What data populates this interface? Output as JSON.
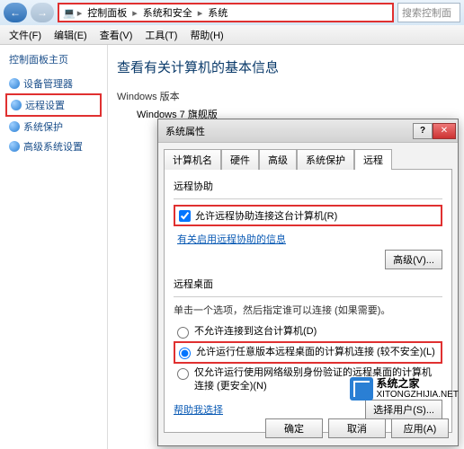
{
  "nav": {
    "crumbs": [
      "控制面板",
      "系统和安全",
      "系统"
    ],
    "search_placeholder": "搜索控制面"
  },
  "menu": [
    "文件(F)",
    "编辑(E)",
    "查看(V)",
    "工具(T)",
    "帮助(H)"
  ],
  "sidebar": {
    "title": "控制面板主页",
    "items": [
      {
        "label": "设备管理器"
      },
      {
        "label": "远程设置"
      },
      {
        "label": "系统保护"
      },
      {
        "label": "高级系统设置"
      }
    ]
  },
  "main": {
    "heading": "查看有关计算机的基本信息",
    "win_section": "Windows 版本",
    "win_edition": "Windows 7 旗舰版"
  },
  "dialog": {
    "title": "系统属性",
    "tabs": [
      "计算机名",
      "硬件",
      "高级",
      "系统保护",
      "远程"
    ],
    "ra_title": "远程协助",
    "ra_check": "允许远程协助连接这台计算机(R)",
    "ra_link": "有关启用远程协助的信息",
    "advanced_btn": "高级(V)...",
    "rd_title": "远程桌面",
    "rd_desc": "单击一个选项，然后指定谁可以连接 (如果需要)。",
    "rd_opts": [
      "不允许连接到这台计算机(D)",
      "允许运行任意版本远程桌面的计算机连接 (较不安全)(L)",
      "仅允许运行使用网络级别身份验证的远程桌面的计算机连接 (更安全)(N)"
    ],
    "help_link": "帮助我选择",
    "select_users": "选择用户(S)...",
    "ok": "确定",
    "cancel": "取消",
    "apply": "应用(A)"
  },
  "brand": {
    "name": "系统之家",
    "url": "XITONGZHIJIA.NET"
  }
}
